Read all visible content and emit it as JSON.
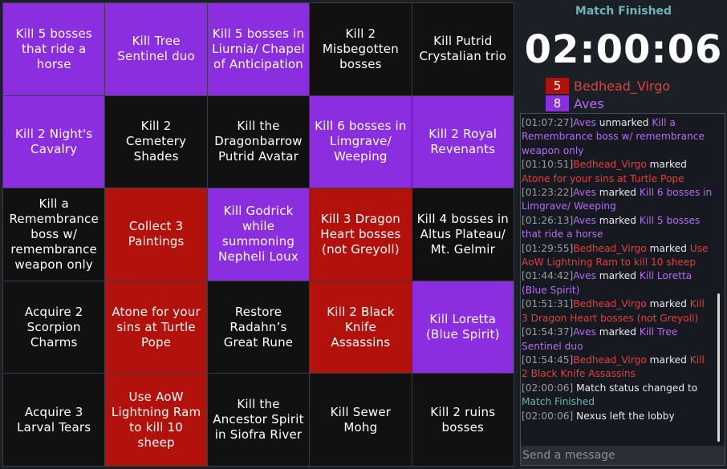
{
  "colors": {
    "red_team": "#b3120c",
    "purple_team": "#8a2ee0",
    "unmarked": "#111111",
    "status_teal": "#6fb3b4"
  },
  "board": {
    "cells": [
      {
        "text": "Kill 5 bosses that ride a horse",
        "color": "purple"
      },
      {
        "text": "Kill Tree Sentinel duo",
        "color": "purple"
      },
      {
        "text": "Kill 5 bosses in Liurnia/ Chapel of Anticipation",
        "color": "purple"
      },
      {
        "text": "Kill 2 Misbegotten bosses",
        "color": "none"
      },
      {
        "text": "Kill Putrid Crystalian trio",
        "color": "none"
      },
      {
        "text": "Kill 2 Night's Cavalry",
        "color": "purple"
      },
      {
        "text": "Kill 2 Cemetery Shades",
        "color": "none"
      },
      {
        "text": "Kill the Dragonbarrow Putrid Avatar",
        "color": "none"
      },
      {
        "text": "Kill 6 bosses in Limgrave/ Weeping",
        "color": "purple"
      },
      {
        "text": "Kill 2 Royal Revenants",
        "color": "purple"
      },
      {
        "text": "Kill a Remembrance boss w/ remembrance weapon only",
        "color": "none"
      },
      {
        "text": "Collect 3 Paintings",
        "color": "red"
      },
      {
        "text": "Kill Godrick while summoning Nepheli Loux",
        "color": "purple"
      },
      {
        "text": "Kill 3 Dragon Heart bosses (not Greyoll)",
        "color": "red"
      },
      {
        "text": "Kill 4 bosses in Altus Plateau/ Mt. Gelmir",
        "color": "none"
      },
      {
        "text": "Acquire 2 Scorpion Charms",
        "color": "none"
      },
      {
        "text": "Atone for your sins at Turtle Pope",
        "color": "red"
      },
      {
        "text": "Restore Radahn’s Great Rune",
        "color": "none"
      },
      {
        "text": "Kill 2 Black Knife Assassins",
        "color": "red"
      },
      {
        "text": "Kill Loretta (Blue Spirit)",
        "color": "purple"
      },
      {
        "text": "Acquire 3 Larval Tears",
        "color": "none"
      },
      {
        "text": "Use AoW Lightning Ram to kill 10 sheep",
        "color": "red"
      },
      {
        "text": "Kill the Ancestor Spirit in Siofra River",
        "color": "none"
      },
      {
        "text": "Kill Sewer Mohg",
        "color": "none"
      },
      {
        "text": "Kill 2 ruins bosses",
        "color": "none"
      }
    ]
  },
  "status": "Match Finished",
  "timer": "02:00:06",
  "players": [
    {
      "score": "5",
      "name": "Bedhead_Virgo",
      "color": "red"
    },
    {
      "score": "8",
      "name": "Aves",
      "color": "purple"
    }
  ],
  "chat": {
    "messages": [
      {
        "time": "[01:07:27]",
        "user": "Aves",
        "user_color": "purple",
        "action": " unmarked ",
        "target": "Kill a Remembrance boss w/ remembrance weapon only"
      },
      {
        "time": "[01:10:51]",
        "user": "Bedhead_Virgo",
        "user_color": "red",
        "action": " marked ",
        "target": "Atone for your sins at Turtle Pope"
      },
      {
        "time": "[01:23:22]",
        "user": "Aves",
        "user_color": "purple",
        "action": " marked ",
        "target": "Kill 6 bosses in Limgrave/ Weeping"
      },
      {
        "time": "[01:26:13]",
        "user": "Aves",
        "user_color": "purple",
        "action": " marked ",
        "target": "Kill 5 bosses that ride a horse"
      },
      {
        "time": "[01:29:55]",
        "user": "Bedhead_Virgo",
        "user_color": "red",
        "action": " marked ",
        "target": "Use AoW Lightning Ram to kill 10 sheep"
      },
      {
        "time": "[01:44:42]",
        "user": "Aves",
        "user_color": "purple",
        "action": " marked ",
        "target": "Kill Loretta (Blue Spirit)"
      },
      {
        "time": "[01:51:31]",
        "user": "Bedhead_Virgo",
        "user_color": "red",
        "action": " marked ",
        "target": "Kill 3 Dragon Heart bosses (not Greyoll)"
      },
      {
        "time": "[01:54:37]",
        "user": "Aves",
        "user_color": "purple",
        "action": " marked ",
        "target": "Kill Tree Sentinel duo"
      },
      {
        "time": "[01:54:45]",
        "user": "Bedhead_Virgo",
        "user_color": "red",
        "action": " marked ",
        "target": "Kill 2 Black Knife Assassins"
      },
      {
        "time": "[02:00:06]",
        "user": "",
        "user_color": "none",
        "action": " Match status changed to ",
        "target": "Match Finished",
        "target_color": "teal"
      },
      {
        "time": "[02:00:06]",
        "user": "",
        "user_color": "none",
        "action": " Nexus left the lobby",
        "target": ""
      }
    ],
    "input_placeholder": "Send a message"
  }
}
